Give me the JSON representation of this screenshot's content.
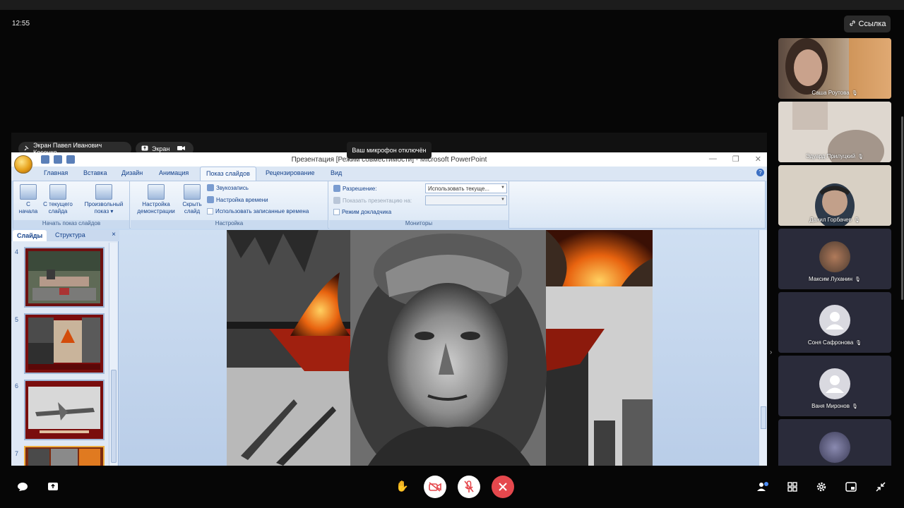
{
  "status_bar": {
    "time": "12:55"
  },
  "header": {
    "link_label": "Ссылка"
  },
  "share": {
    "presenter_label": "Экран Павел Иванович Косенко",
    "screen_chip_label": "Экран",
    "tooltip": "Ваш микрофон отключён"
  },
  "ppt": {
    "window_title": "Презентация [Режим совместимости] - Microsoft PowerPoint",
    "tabs": [
      "Главная",
      "Вставка",
      "Дизайн",
      "Анимация",
      "Показ слайдов",
      "Рецензирование",
      "Вид"
    ],
    "active_tab": "Показ слайдов",
    "ribbon": {
      "group_start": {
        "label": "Начать показ слайдов",
        "from_start": [
          "С",
          "начала"
        ],
        "from_current": [
          "С текущего",
          "слайда"
        ],
        "custom": [
          "Произвольный",
          "показ"
        ]
      },
      "group_setup": {
        "label": "Настройка",
        "setup_show": [
          "Настройка",
          "демонстрации"
        ],
        "hide_slide": [
          "Скрыть",
          "слайд"
        ],
        "record_narration": "Звукозапись",
        "rehearse_timings": "Настройка времени",
        "use_timings": "Использовать записанные времена"
      },
      "group_monitors": {
        "label": "Мониторы",
        "resolution_label": "Разрешение:",
        "resolution_value": "Использовать текуще...",
        "show_on_label": "Показать презентацию на:",
        "presenter_view": "Режим докладчика"
      }
    },
    "pane": {
      "tab_slides": "Слайды",
      "tab_outline": "Структура",
      "close": "×",
      "slides": [
        {
          "num": "4"
        },
        {
          "num": "5"
        },
        {
          "num": "6"
        },
        {
          "num": "7"
        }
      ]
    }
  },
  "participants": [
    {
      "name": "Саша Роутова"
    },
    {
      "name": "Эдуард Прилуцкий"
    },
    {
      "name": "Данил Горбачев"
    },
    {
      "name": "Максим Луханин"
    },
    {
      "name": "Соня Сафронова"
    },
    {
      "name": "Ваня Миронов"
    },
    {
      "name": ""
    }
  ],
  "colors": {
    "end_call": "#e5484d",
    "ribbon_text": "#15428b",
    "ppt_background": "#c5d9f1"
  }
}
